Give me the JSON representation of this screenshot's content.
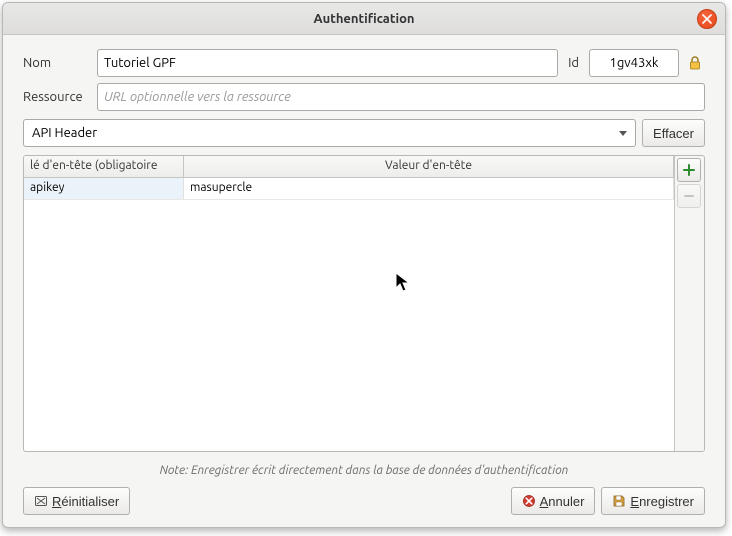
{
  "title": "Authentification",
  "labels": {
    "name": "Nom",
    "id": "Id",
    "resource": "Ressource"
  },
  "name_value": "Tutoriel GPF",
  "id_value": "1gv43xk",
  "resource_placeholder": "URL optionnelle vers la ressource",
  "auth_type": "API Header",
  "clear_button": "Effacer",
  "table": {
    "header_key": "lé d'en-tête (obligatoire",
    "header_value": "Valeur d'en-tête",
    "rows": [
      {
        "key": "apikey",
        "value": "masupercle"
      }
    ]
  },
  "note": "Note: Enregistrer écrit directement dans la base de données d'authentification",
  "buttons": {
    "reset": "Réinitialiser",
    "cancel": "Annuler",
    "save": "Enregistrer"
  }
}
